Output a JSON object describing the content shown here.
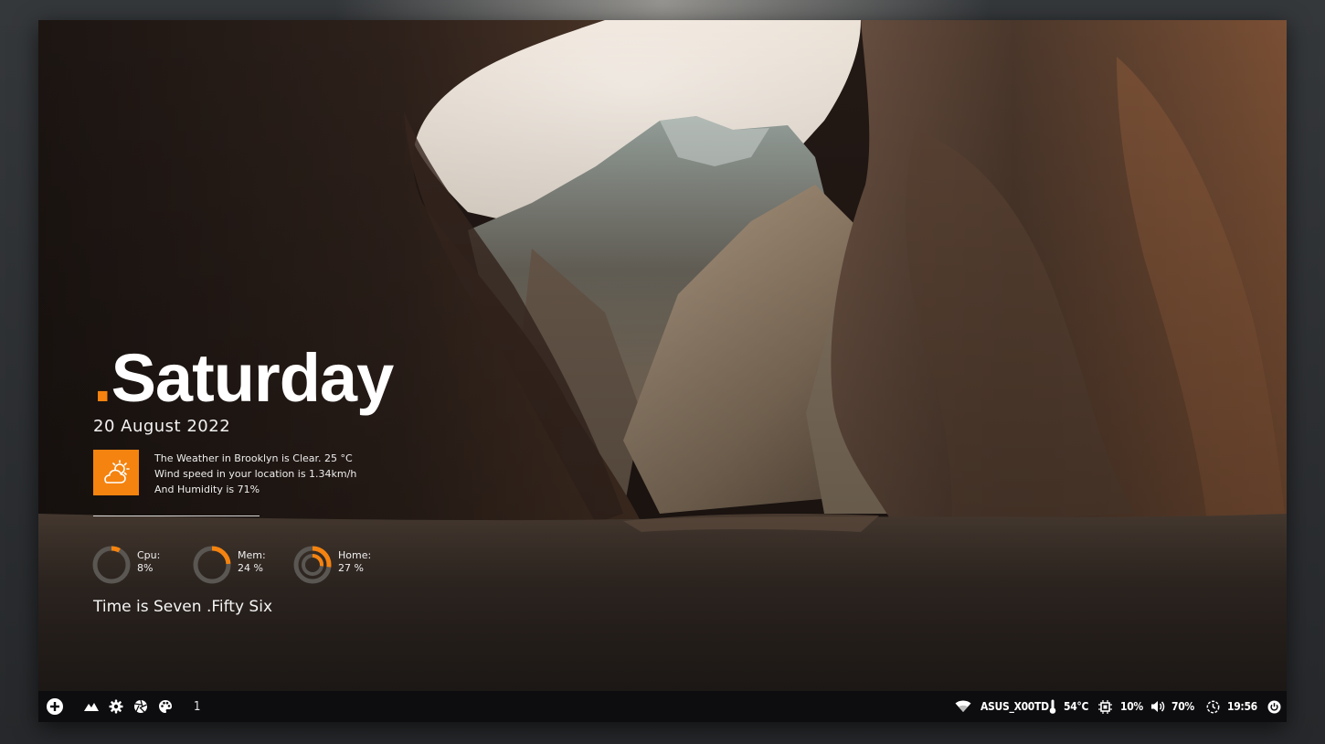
{
  "wallpaper": {
    "subject": "cave-mountain-landscape"
  },
  "widget": {
    "day_dot": ".",
    "day": "Saturday",
    "date": "20 August 2022",
    "weather": {
      "icon": "partly-cloudy-icon",
      "line1": "The Weather in Brooklyn is Clear. 25 °C",
      "line2": "Wind speed in your location is 1.34km/h",
      "line3": "And Humidity is 71%"
    },
    "gauges": [
      {
        "label": "Cpu:",
        "value": "8%",
        "fraction": 0.08
      },
      {
        "label": "Mem:",
        "value": "24 %",
        "fraction": 0.24
      },
      {
        "label": "Home:",
        "value": "27 %",
        "fraction": 0.27
      }
    ],
    "time_text": "Time is Seven .Fifty Six"
  },
  "taskbar": {
    "workspace": "1",
    "wifi_name": "ASUS_X00TD",
    "temperature": "54°C",
    "cpu": "10%",
    "volume": "70%",
    "clock": "19:56",
    "left_icons": [
      "add-icon",
      "mountain-icon",
      "gear-icon",
      "aperture-icon",
      "palette-icon"
    ],
    "right_icons": [
      "wifi-icon",
      "thermometer-icon",
      "cpu-chip-icon",
      "speaker-icon",
      "clock-icon",
      "power-icon"
    ]
  },
  "colors": {
    "accent": "#f5830f",
    "taskbar_bg": "#0d0d10",
    "gauge_track": "#5a5652"
  }
}
